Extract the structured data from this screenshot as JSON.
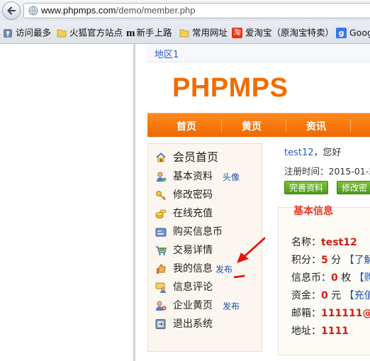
{
  "browser": {
    "url_host": "www.phpmps.com",
    "url_path": "/demo/member.php",
    "bookmarks": [
      {
        "label": "访问最多",
        "icon": "pin-icon"
      },
      {
        "label": "火狐官方站点",
        "icon": "folder-icon"
      },
      {
        "label": "新手上路",
        "icon": "m-logo-icon"
      },
      {
        "label": "常用网址",
        "icon": "folder-icon"
      },
      {
        "label": "爱淘宝（原淘宝特卖）",
        "icon": "taobao-icon"
      },
      {
        "label": "Goog",
        "icon": "google-icon"
      }
    ]
  },
  "breadcrumb": {
    "label": "地区1"
  },
  "site": {
    "logo": "PHPMPS",
    "brand_color": "#f36b00"
  },
  "nav": {
    "items": [
      "首页",
      "黄页",
      "资讯"
    ]
  },
  "sidebar": {
    "items": [
      {
        "label": "会员首页",
        "icon": "house-icon"
      },
      {
        "label": "基本资料",
        "sub": "头像",
        "icon": "user-icon"
      },
      {
        "label": "修改密码",
        "icon": "key-icon"
      },
      {
        "label": "在线充值",
        "icon": "coins-icon"
      },
      {
        "label": "购买信息币",
        "icon": "card-icon"
      },
      {
        "label": "交易详情",
        "icon": "cart-icon"
      },
      {
        "label": "我的信息",
        "sub": "发布",
        "icon": "thumb-icon"
      },
      {
        "label": "信息评论",
        "icon": "comment-user-icon"
      },
      {
        "label": "企业黄页",
        "sub": "发布",
        "icon": "user-minus-icon"
      },
      {
        "label": "退出系统",
        "icon": "exit-icon"
      }
    ]
  },
  "welcome": {
    "user": "test12",
    "greeting": "，您好"
  },
  "reg_time": {
    "text": "注册时间：2015-01-2"
  },
  "buttons": {
    "complete_profile": "完善资料",
    "change_password": "修改密"
  },
  "info": {
    "title": "基本信息",
    "rows": [
      {
        "label": "名称：",
        "value": "test12",
        "extra": ""
      },
      {
        "label": "积分：",
        "value": "5",
        "unit": " 分 ",
        "extra": "【了解"
      },
      {
        "label": "信息币：",
        "value": "0",
        "unit": " 枚 ",
        "extra": "【购"
      },
      {
        "label": "资金：",
        "value": "0",
        "unit": " 元 ",
        "extra": "【充值"
      },
      {
        "label": "邮箱：",
        "value": "111111@",
        "extra": ""
      },
      {
        "label": "地址：",
        "value": "1111",
        "extra": ""
      }
    ]
  },
  "annotation_color": "#e8120c"
}
